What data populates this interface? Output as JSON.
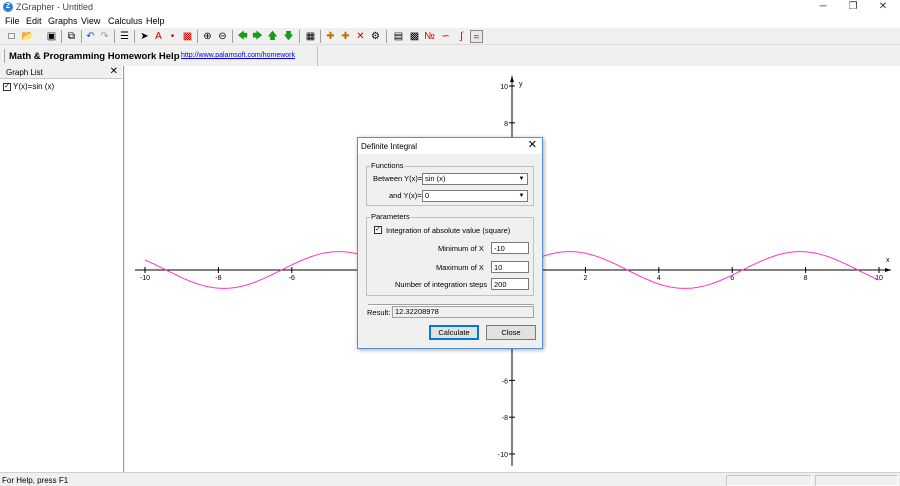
{
  "window": {
    "title": "ZGrapher - Untitled",
    "app_icon_letter": "Z",
    "minimize_glyph": "─",
    "restore_glyph": "❐",
    "close_glyph": "✕"
  },
  "menu": [
    "File",
    "Edit",
    "Graphs",
    "View",
    "Calculus",
    "Help"
  ],
  "toolbar": {
    "icons": [
      "new-icon",
      "open-icon",
      "save-icon",
      "copy-icon",
      "undo-icon",
      "redo-icon",
      "list-icon",
      "pointer-icon",
      "point-icon",
      "zoom-in-icon",
      "zoom-out-icon",
      "arrow-left-icon",
      "arrow-right-icon",
      "arrow-up-icon",
      "arrow-down-icon",
      "close-icon",
      "calculator-icon",
      "integral-icon",
      "derivative-icon"
    ]
  },
  "helpbar": {
    "title": "Math & Programming Homework Help",
    "link": "http://www.palamsoft.com/homework"
  },
  "graph_list": {
    "title": "Graph List",
    "close_glyph": "✕",
    "items": [
      {
        "label": "Y(x)=sin (x)",
        "checked": true
      }
    ]
  },
  "plot": {
    "x_axis_label": "x",
    "y_axis_label": "y",
    "x_range": [
      -10,
      10
    ],
    "y_range": [
      -10,
      10
    ],
    "x_tick_labels": [
      "-10",
      "-8",
      "-6",
      "2",
      "4",
      "6",
      "8",
      "10"
    ],
    "y_tick_labels": [
      "10",
      "8",
      "-6",
      "-8",
      "-10"
    ],
    "curve_color": "#ff33cc",
    "function": "sin(x)"
  },
  "dialog": {
    "title": "Definite Integral",
    "close_glyph": "✕",
    "functions_group": "Functions",
    "between_label": "Between Y(x)=",
    "between_value": "sin (x)",
    "and_label": "and Y(x)=",
    "and_value": "0",
    "parameters_group": "Parameters",
    "abs_checkbox_label": "Integration of absolute value (square)",
    "abs_checked": true,
    "min_x_label": "Minimum of X",
    "min_x_value": "-10",
    "max_x_label": "Maximum of X",
    "max_x_value": "10",
    "steps_label": "Number of integration steps",
    "steps_value": "200",
    "result_label": "Result:",
    "result_value": "12.32208978",
    "calculate_label": "Calculate",
    "close_label": "Close"
  },
  "status": {
    "text": "For Help, press F1"
  },
  "colors": {
    "link": "#0000ee",
    "dialog_border": "#5a8fd0",
    "default_button_border": "#0078d7"
  }
}
